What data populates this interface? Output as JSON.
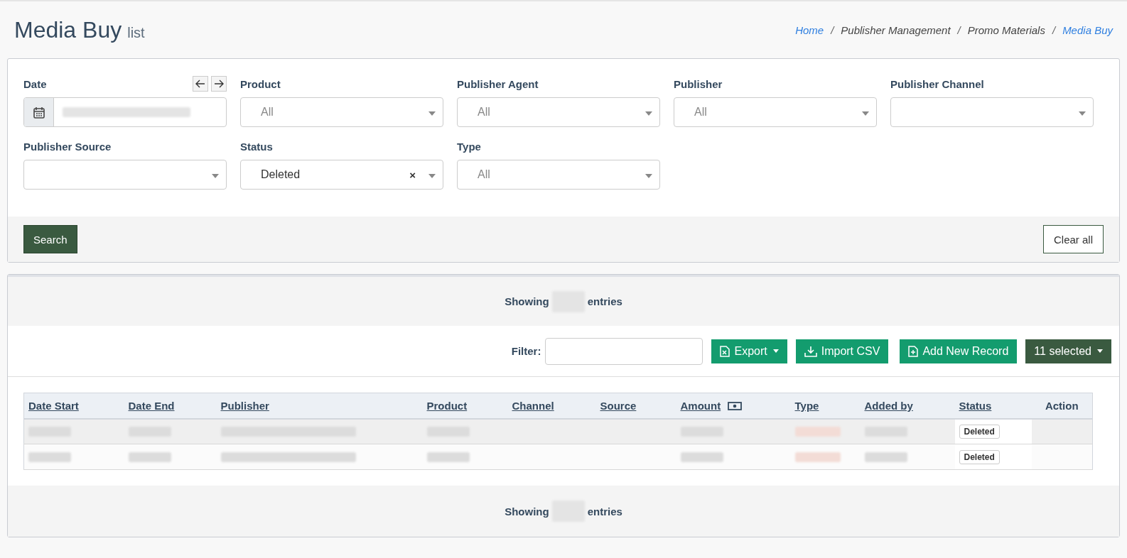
{
  "header": {
    "title": "Media Buy",
    "subtitle": "list",
    "breadcrumb": [
      {
        "label": "Home",
        "kind": "link"
      },
      {
        "sep": "/",
        "label": "Publisher Management",
        "kind": "text"
      },
      {
        "sep": "/",
        "label": "Promo Materials",
        "kind": "text"
      },
      {
        "sep": "/",
        "label": "Media Buy",
        "kind": "link"
      }
    ]
  },
  "filters": [
    {
      "label": "Date",
      "kind": "date"
    },
    {
      "label": "Product",
      "kind": "select",
      "placeholder": "All"
    },
    {
      "label": "Publisher Agent",
      "kind": "select",
      "placeholder": "All"
    },
    {
      "label": "Publisher",
      "kind": "select",
      "placeholder": "All"
    },
    {
      "label": "Publisher Channel",
      "kind": "select"
    },
    {
      "label": "Publisher Source",
      "kind": "select"
    },
    {
      "label": "Status",
      "kind": "select",
      "value": "Deleted",
      "clear_glyph": "×"
    },
    {
      "label": "Type",
      "kind": "select",
      "placeholder": "All"
    }
  ],
  "search_button": "Search",
  "clear_button": "Clear all",
  "results": {
    "showing_top": {
      "before": "Showing",
      "after": "entries"
    },
    "filter_label": "Filter:",
    "buttons": [
      {
        "label": "Export",
        "kind": "export",
        "dropdown": true
      },
      {
        "label": "Import CSV",
        "kind": "import",
        "dropdown": false
      },
      {
        "label": "Add New Record",
        "kind": "add",
        "dropdown": false
      },
      {
        "label": "11 selected",
        "kind": "columns",
        "dropdown": true
      }
    ],
    "table": {
      "columns": [
        {
          "label": "Date Start",
          "sortable": true,
          "kind": "redacted"
        },
        {
          "label": "Date End",
          "sortable": true,
          "kind": "redacted"
        },
        {
          "label": "Publisher",
          "sortable": true,
          "kind": "redacted-long"
        },
        {
          "label": "Product",
          "sortable": true,
          "kind": "redacted"
        },
        {
          "label": "Channel",
          "sortable": true,
          "kind": "empty"
        },
        {
          "label": "Source",
          "sortable": true,
          "kind": "empty"
        },
        {
          "label": "Amount",
          "sortable": true,
          "kind": "amount"
        },
        {
          "label": "Type",
          "sortable": true,
          "kind": "redacted-tag"
        },
        {
          "label": "Added by",
          "sortable": true,
          "kind": "redacted"
        },
        {
          "label": "Status",
          "sortable": true,
          "kind": "status"
        },
        {
          "label": "Action",
          "sortable": false,
          "kind": "empty"
        }
      ],
      "rows": [
        {
          "status": "Deleted",
          "highlighted": true
        },
        {
          "status": "Deleted",
          "highlighted": false
        }
      ]
    },
    "showing_bottom": {
      "before": "Showing",
      "after": "entries"
    }
  }
}
